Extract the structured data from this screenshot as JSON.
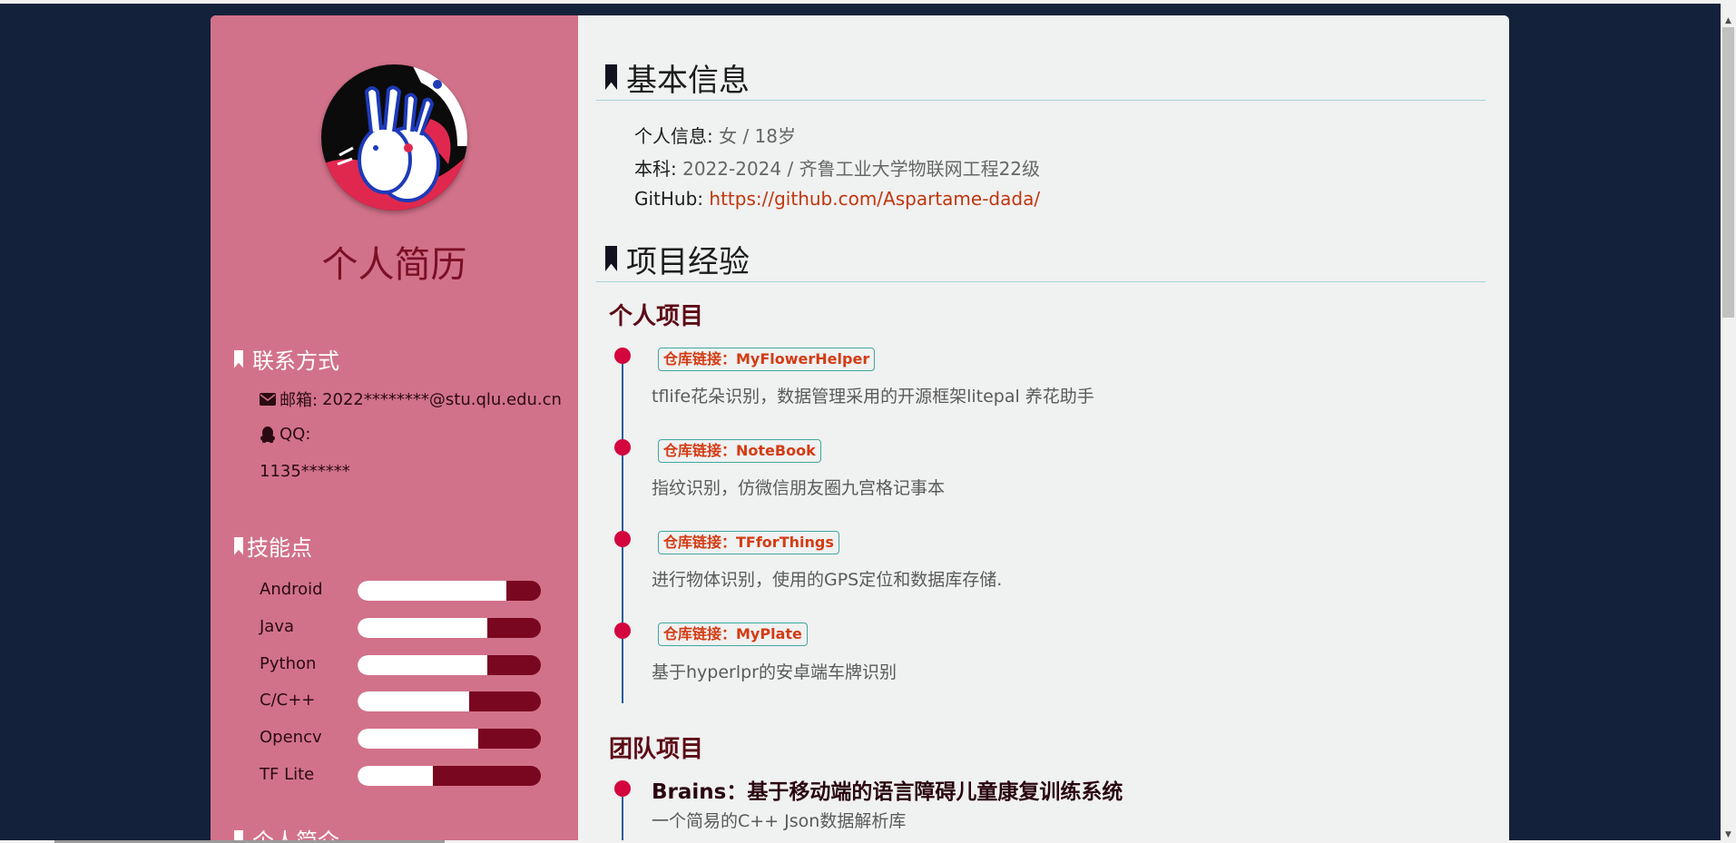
{
  "sidebar": {
    "title": "个人简历",
    "contact": {
      "heading": "联系方式",
      "email_label": "邮箱:",
      "email": "2022********@stu.qlu.edu.cn",
      "qq_label": "QQ:",
      "qq": "1135******"
    },
    "skills": {
      "heading": "技能点",
      "items": [
        {
          "name": "Android",
          "level": 0.81
        },
        {
          "name": "Java",
          "level": 0.71
        },
        {
          "name": "Python",
          "level": 0.71
        },
        {
          "name": "C/C++",
          "level": 0.61
        },
        {
          "name": "Opencv",
          "level": 0.66
        },
        {
          "name": "TF Lite",
          "level": 0.41
        }
      ]
    },
    "intro": {
      "heading": "个人简介"
    }
  },
  "main": {
    "basic": {
      "heading": "基本信息",
      "personal_label": "个人信息:",
      "personal": "女 / 18岁",
      "edu_label": "本科:",
      "edu": "2022-2024 / 齐鲁工业大学物联网工程22级",
      "github_label": "GitHub:",
      "github": "https://github.com/Aspartame-dada/"
    },
    "projects": {
      "heading": "项目经验",
      "personal_heading": "个人项目",
      "personal_items": [
        {
          "repo": "仓库链接：MyFlowerHelper",
          "desc": "tflife花朵识别，数据管理采用的开源框架litepal 养花助手"
        },
        {
          "repo": "仓库链接：NoteBook",
          "desc": "指纹识别，仿微信朋友圈九宫格记事本"
        },
        {
          "repo": "仓库链接：TFforThings",
          "desc": "进行物体识别，使用的GPS定位和数据库存储."
        },
        {
          "repo": "仓库链接：MyPlate",
          "desc": "基于hyperlpr的安卓端车牌识别"
        }
      ],
      "team_heading": "团队项目",
      "team_items": [
        {
          "title": "Brains：基于移动端的语言障碍儿童康复训练系统",
          "desc": "一个简易的C++ Json数据解析库"
        }
      ]
    }
  },
  "colors": {
    "background": "#13213a",
    "sidebar": "#d2728a",
    "main": "#f0f1f1",
    "accent_dark": "#7a0720",
    "timeline_dot": "#d3063e",
    "link": "#c0360e"
  }
}
